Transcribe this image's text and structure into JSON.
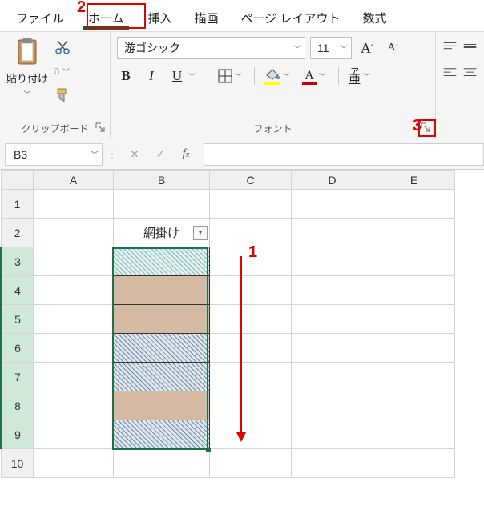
{
  "tabs": {
    "file": "ファイル",
    "home": "ホーム",
    "insert": "挿入",
    "draw": "描画",
    "page_layout": "ページ レイアウト",
    "formulas": "数式"
  },
  "clipboard": {
    "paste_label": "貼り付け",
    "group_label": "クリップボード"
  },
  "font": {
    "family": "游ゴシック",
    "size": "11",
    "group_label": "フォント",
    "ruby_label": "ア\n亜",
    "bold": "B",
    "italic": "I",
    "underline": "U",
    "grow": "A",
    "shrink": "A",
    "color_glyph": "A",
    "font_color": "#d40000",
    "fill_color": "#ffff00"
  },
  "namebox": {
    "value": "B3"
  },
  "columns": [
    "A",
    "B",
    "C",
    "D",
    "E"
  ],
  "rows": [
    "1",
    "2",
    "3",
    "4",
    "5",
    "6",
    "7",
    "8",
    "9",
    "10"
  ],
  "cells": {
    "B2": "網掛け"
  },
  "annotations": {
    "one": "1",
    "two": "2",
    "three": "3"
  }
}
